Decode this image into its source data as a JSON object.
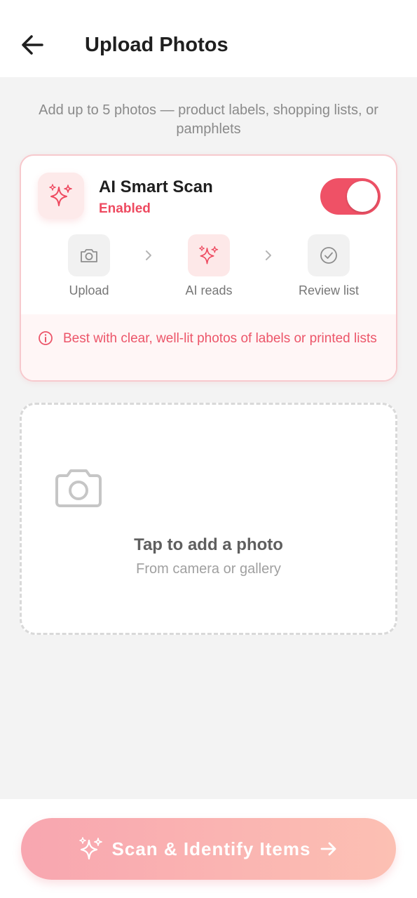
{
  "header": {
    "title": "Upload Photos",
    "back_icon": "arrow-left-icon"
  },
  "subtitle": "Add up to 5 photos — product labels, shopping lists, or pamphlets",
  "ai_scan": {
    "title": "AI Smart Scan",
    "status": "Enabled",
    "enabled": true,
    "icon": "sparkles-icon",
    "steps": [
      {
        "label": "Upload",
        "icon": "camera-icon"
      },
      {
        "label": "AI reads",
        "icon": "sparkles-icon"
      },
      {
        "label": "Review list",
        "icon": "check-circle-icon"
      }
    ],
    "tip": "Best with clear, well-lit photos of labels or printed lists"
  },
  "upload": {
    "title": "Tap to add a photo",
    "subtitle": "From camera or gallery",
    "icon": "camera-icon"
  },
  "cta": {
    "label": "Scan & Identify Items",
    "icon": "sparkles-icon",
    "trailing_icon": "arrow-right-icon"
  },
  "colors": {
    "accent": "#ef5166",
    "accent_text": "#ee4a60",
    "card_border": "#f7c9cd",
    "tip_bg": "#fff6f6",
    "background": "#f3f3f3"
  }
}
